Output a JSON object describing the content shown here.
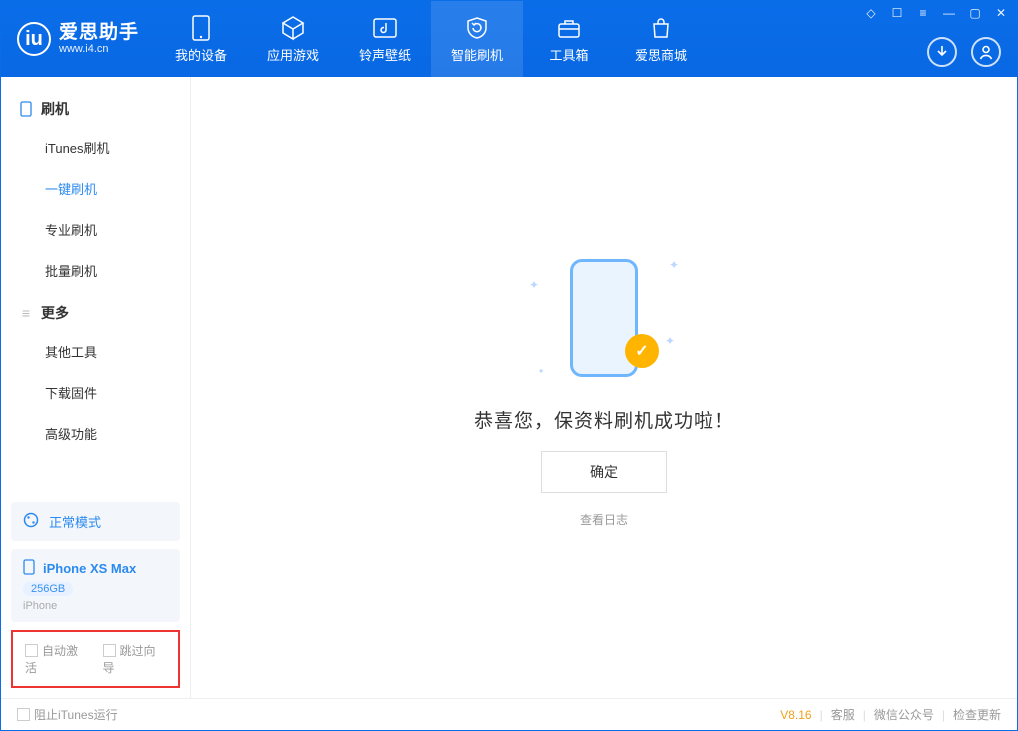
{
  "app": {
    "name_cn": "爱思助手",
    "url": "www.i4.cn"
  },
  "nav": [
    {
      "label": "我的设备"
    },
    {
      "label": "应用游戏"
    },
    {
      "label": "铃声壁纸"
    },
    {
      "label": "智能刷机"
    },
    {
      "label": "工具箱"
    },
    {
      "label": "爱思商城"
    }
  ],
  "sidebar": {
    "group1": {
      "title": "刷机",
      "items": [
        "iTunes刷机",
        "一键刷机",
        "专业刷机",
        "批量刷机"
      ]
    },
    "group2": {
      "title": "更多",
      "items": [
        "其他工具",
        "下载固件",
        "高级功能"
      ]
    }
  },
  "mode": {
    "label": "正常模式"
  },
  "device": {
    "name": "iPhone XS Max",
    "capacity": "256GB",
    "type": "iPhone"
  },
  "options": {
    "auto_activate": "自动激活",
    "skip_guide": "跳过向导"
  },
  "main": {
    "success_text": "恭喜您，保资料刷机成功啦！",
    "ok_button": "确定",
    "log_link": "查看日志"
  },
  "statusbar": {
    "block_itunes": "阻止iTunes运行",
    "version": "V8.16",
    "links": [
      "客服",
      "微信公众号",
      "检查更新"
    ]
  }
}
